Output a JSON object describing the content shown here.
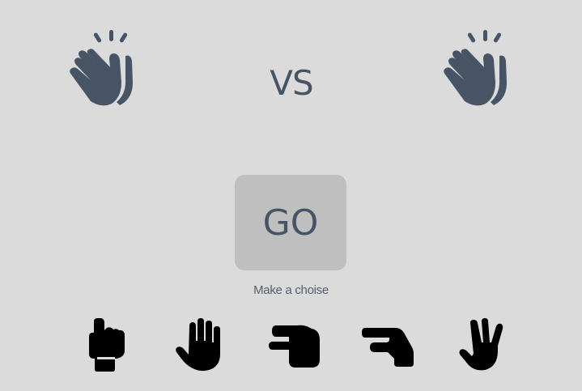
{
  "game": {
    "vs_label": "VS",
    "go_label": "GO",
    "hint": "Make a choise"
  },
  "players": {
    "left": {
      "icon": "hand-wave-icon",
      "state": "waiting"
    },
    "right": {
      "icon": "hand-wave-icon",
      "state": "waiting"
    }
  },
  "choices": [
    {
      "id": "rock",
      "icon": "hand-rock-icon"
    },
    {
      "id": "paper",
      "icon": "hand-paper-icon"
    },
    {
      "id": "scissors",
      "icon": "hand-scissors-icon"
    },
    {
      "id": "lizard",
      "icon": "hand-lizard-icon"
    },
    {
      "id": "spock",
      "icon": "hand-spock-icon"
    }
  ],
  "colors": {
    "background": "#dbdbdb",
    "accent": "#465465",
    "button": "#bfbfbf",
    "choice_icon": "#000000"
  }
}
